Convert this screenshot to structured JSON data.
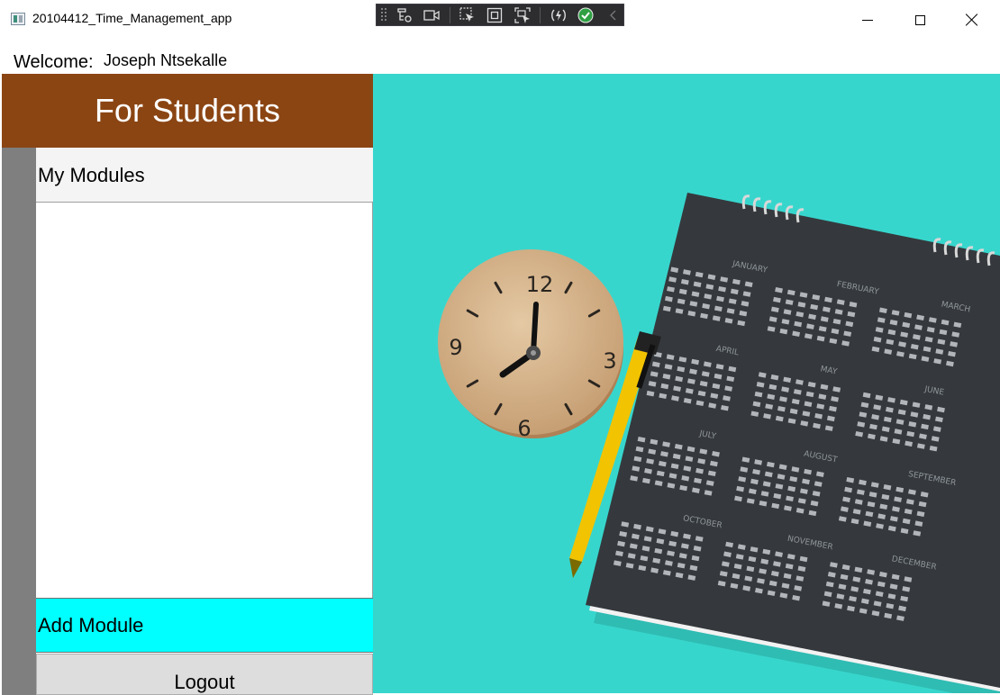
{
  "window": {
    "title": "20104412_Time_Management_app"
  },
  "welcome": {
    "label": "Welcome:",
    "user": "Joseph Ntsekalle"
  },
  "panel": {
    "header": "For Students",
    "section_title": "My Modules",
    "modules": [],
    "add_label": "Add Module",
    "logout_label": "Logout"
  },
  "colors": {
    "header_bg": "#8b4513",
    "add_button_bg": "#00ffff",
    "photo_bg": "#37d6cd"
  },
  "photo": {
    "clock_numerals": [
      "12",
      "3",
      "6",
      "9"
    ],
    "calendar_months": [
      "JANUARY",
      "FEBRUARY",
      "MARCH",
      "APRIL",
      "MAY",
      "JUNE",
      "JULY",
      "AUGUST",
      "SEPTEMBER",
      "OCTOBER",
      "NOVEMBER",
      "DECEMBER"
    ]
  },
  "icons": {
    "app": "app-window-icon",
    "toolbar": [
      "live-visual-tree-icon",
      "record-icon",
      "select-element-icon",
      "layout-adorner-icon",
      "track-focus-icon",
      "hot-reload-icon",
      "status-ok-icon",
      "collapse-icon"
    ]
  }
}
